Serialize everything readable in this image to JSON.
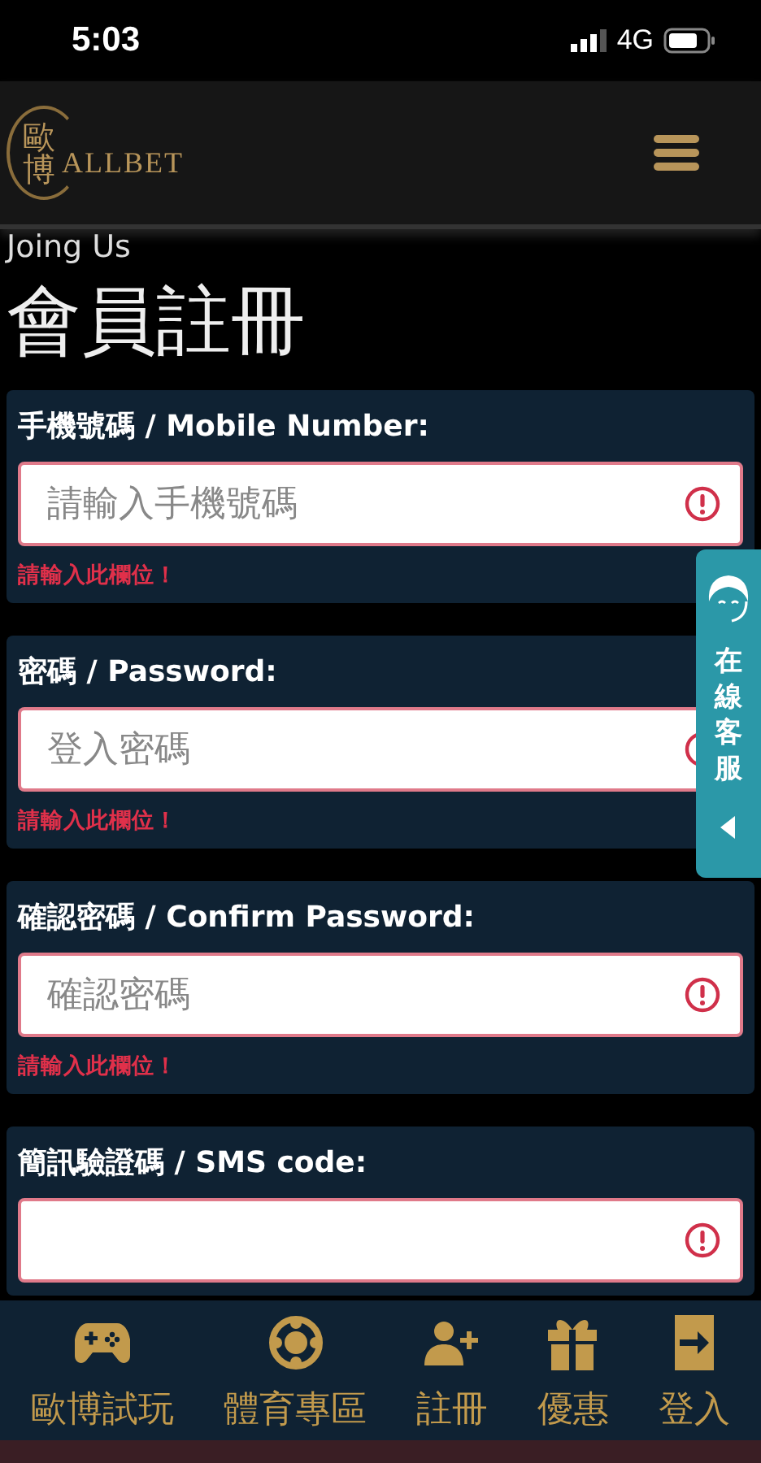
{
  "status_bar": {
    "time": "5:03",
    "network": "4G"
  },
  "header": {
    "logo_mark": "歐博",
    "logo_text": "ALLBET"
  },
  "page": {
    "subtitle": "Joing Us",
    "title": "會員註冊"
  },
  "fields": [
    {
      "label": "手機號碼 / Mobile Number:",
      "placeholder": "請輸入手機號碼",
      "invalid": true,
      "error": "請輸入此欄位！"
    },
    {
      "label": "密碼 / Password:",
      "placeholder": "登入密碼",
      "invalid": true,
      "error": "請輸入此欄位！"
    },
    {
      "label": "確認密碼 / Confirm Password:",
      "placeholder": "確認密碼",
      "invalid": true,
      "error": "請輸入此欄位！"
    },
    {
      "label": "簡訊驗證碼 / SMS code:",
      "invalid": true
    }
  ],
  "support_tab": {
    "label": "在線客服"
  },
  "bottom_nav": [
    {
      "kind": "gamepad",
      "label": "歐博試玩"
    },
    {
      "kind": "ball",
      "label": "體育專區"
    },
    {
      "kind": "adduser",
      "label": "註冊"
    },
    {
      "kind": "gift",
      "label": "優惠"
    },
    {
      "kind": "login",
      "label": "登入"
    }
  ]
}
